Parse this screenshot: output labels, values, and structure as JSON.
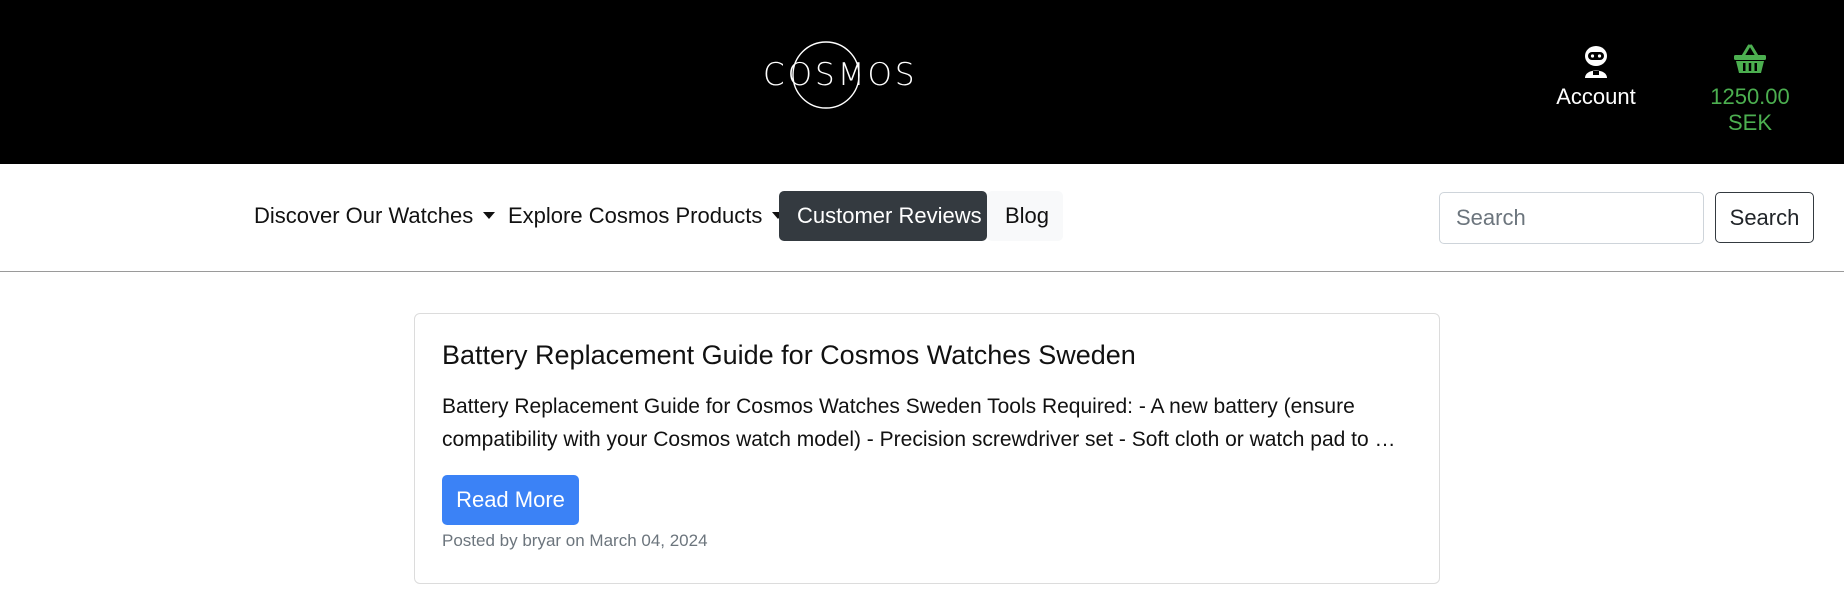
{
  "header": {
    "logo_text": "COSMOS",
    "account_label": "Account",
    "account_icon": "astronaut-icon",
    "cart_total": "1250.00 SEK",
    "cart_icon": "basket-icon",
    "cart_color": "#4caf50"
  },
  "nav": {
    "items": [
      {
        "label": "Discover Our Watches",
        "dropdown": true
      },
      {
        "label": "Explore Cosmos Products",
        "dropdown": true
      },
      {
        "label": "Customer Reviews",
        "active": true
      },
      {
        "label": "Blog"
      }
    ],
    "search": {
      "placeholder": "Search",
      "value": "",
      "button_label": "Search"
    }
  },
  "post": {
    "title": "Battery Replacement Guide for Cosmos Watches Sweden",
    "excerpt": "Battery Replacement Guide for Cosmos Watches Sweden Tools Required: - A new battery (ensure compatibility with your Cosmos watch model) - Precision screwdriver set - Soft cloth or watch pad to …",
    "read_more_label": "Read More",
    "meta": "Posted by bryar on March 04, 2024"
  },
  "colors": {
    "header_bg": "#000000",
    "active_nav_bg": "#343a40",
    "primary_button": "#3b82f6"
  }
}
